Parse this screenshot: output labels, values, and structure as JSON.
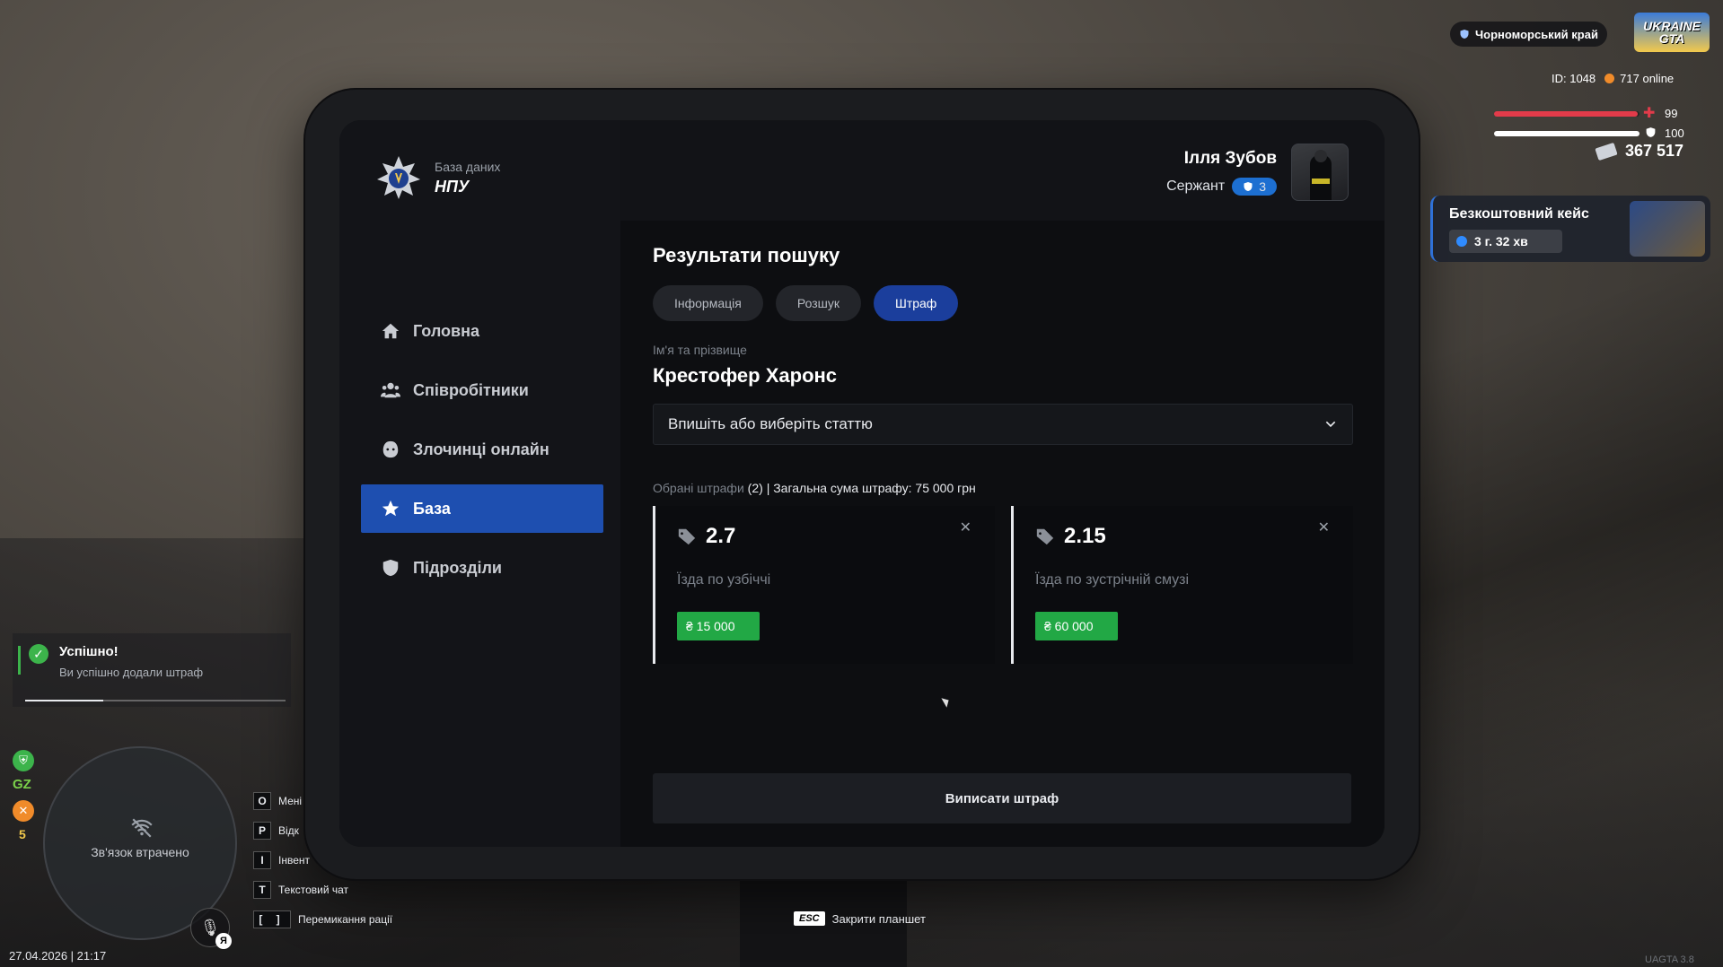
{
  "tablet": {
    "brand": {
      "subtitle": "База даних",
      "title": "НПУ"
    },
    "nav": [
      {
        "label": "Головна",
        "icon": "home-icon"
      },
      {
        "label": "Співробітники",
        "icon": "people-icon"
      },
      {
        "label": "Злочинці онлайн",
        "icon": "mask-icon"
      },
      {
        "label": "База",
        "icon": "star-icon",
        "active": true
      },
      {
        "label": "Підрозділи",
        "icon": "shield-icon"
      }
    ],
    "user": {
      "name": "Ілля Зубов",
      "rank": "Сержант",
      "rank_level": "3"
    },
    "main": {
      "title": "Результати пошуку",
      "tabs": [
        {
          "label": "Інформація"
        },
        {
          "label": "Розшук"
        },
        {
          "label": "Штраф",
          "active": true
        }
      ],
      "name_label": "Ім'я та прізвище",
      "person_name": "Крестофер Харонс",
      "article_select": "Впишіть або виберіть статтю",
      "summary_label": "Обрані штрафи",
      "summary_count": "(2)",
      "summary_total": "| Загальна сума штрафу: 75 000 грн",
      "fines": [
        {
          "code": "2.7",
          "desc": "Їзда по узбіччі",
          "amount": "₴ 15 000"
        },
        {
          "code": "2.15",
          "desc": "Їзда по зустрічній смузі",
          "amount": "₴ 60 000"
        }
      ],
      "issue_button": "Виписати штраф"
    }
  },
  "hud": {
    "server": "Чорноморський край",
    "logo_line1": "UKRAINE",
    "logo_line2": "GTA",
    "player_id": "ID: 1048",
    "online": "717 online",
    "health": "99",
    "armor": "100",
    "health_fraction": 0.99,
    "armor_fraction": 1.0,
    "money": "367 517",
    "case_title": "Безкоштовний кейс",
    "case_timer": "3 г. 32 хв",
    "toast_title": "Успішно!",
    "toast_sub": "Ви успішно додали штраф",
    "toast_progress": 0.3,
    "gz": "GZ",
    "wanted": "5",
    "minimap_status": "Зв'язок втрачено",
    "mic_key": "Я",
    "keys": [
      {
        "key": "O",
        "label": "Мені"
      },
      {
        "key": "P",
        "label": "Відк"
      },
      {
        "key": "I",
        "label": "Інвент"
      },
      {
        "key": "T",
        "label": "Текстовий чат"
      },
      {
        "key": "[ ]",
        "label": "Перемикання рації"
      }
    ],
    "datetime": "27.04.2026 | 21:17",
    "esc_key": "ESC",
    "esc_label": "Закрити планшет",
    "version": "UAGTA 3.8"
  },
  "colors": {
    "accent": "#1e4fb0",
    "tab_active": "#1b3e9c",
    "fine_amount": "#22a845",
    "health": "#e23b4a",
    "armor": "#ffffff"
  }
}
